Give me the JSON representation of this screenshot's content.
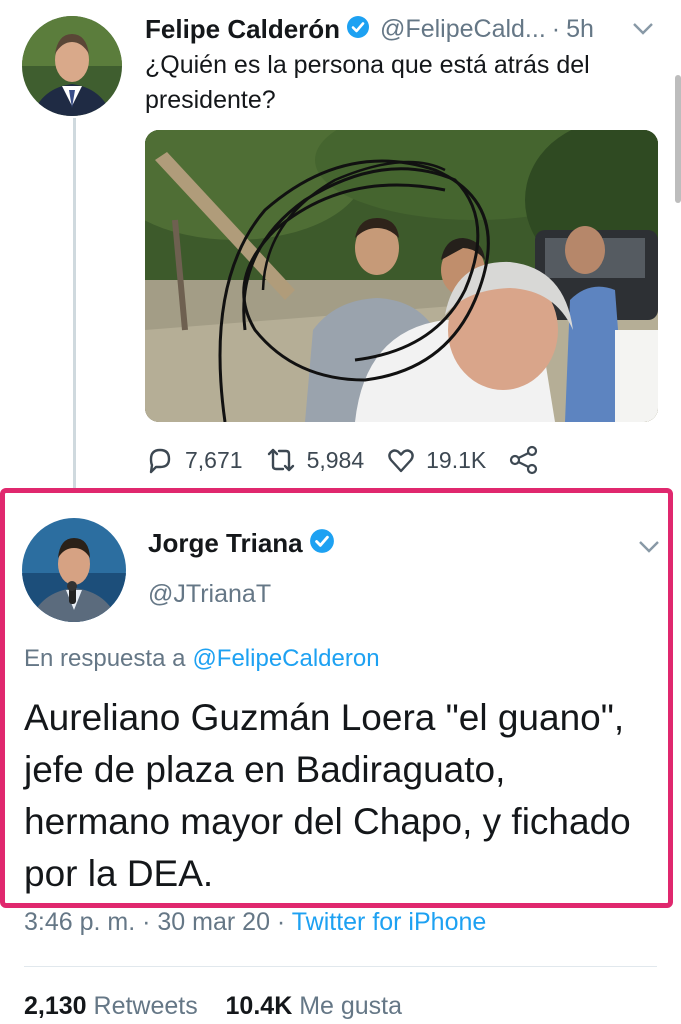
{
  "tweet1": {
    "name": "Felipe Calderón",
    "handle": "@FelipeCald...",
    "time": "5h",
    "dot": "·",
    "text": "¿Quién es la persona que está atrás del presidente?",
    "stats": {
      "replies": "7,671",
      "retweets": "5,984",
      "likes": "19.1K"
    }
  },
  "tweet2": {
    "name": "Jorge Triana",
    "handle": "@JTrianaT",
    "reply_prefix": "En respuesta a",
    "reply_to": "@FelipeCalderon",
    "text": "Aureliano Guzmán Loera \"el guano\", jefe de plaza en Badiraguato, hermano mayor del Chapo, y fichado por la DEA.",
    "time": "3:46 p. m.",
    "sep1": "·",
    "date": "30 mar 20",
    "sep2": "·",
    "source": "Twitter for iPhone",
    "retweets_count": "2,130",
    "retweets_label": "Retweets",
    "likes_count": "10.4K",
    "likes_label": "Me gusta"
  },
  "colors": {
    "highlight_border": "#e0286e",
    "link": "#1da1f2",
    "verified": "#1da1f2",
    "muted": "#657786"
  },
  "icons": [
    "verified-badge-icon",
    "chevron-down-icon",
    "reply-icon",
    "retweet-icon",
    "like-icon",
    "share-icon"
  ]
}
